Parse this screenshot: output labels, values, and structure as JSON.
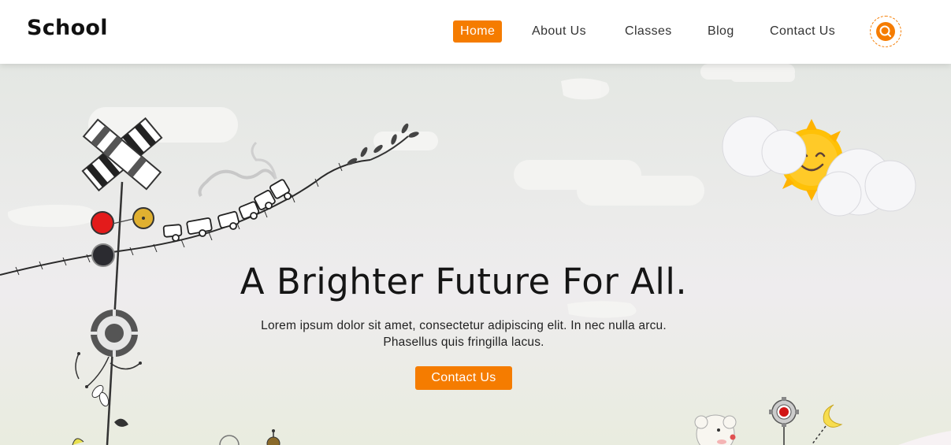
{
  "brand": {
    "logo_text": "School",
    "accent_color": "#f57c00"
  },
  "nav": {
    "items": [
      {
        "label": "Home",
        "active": true
      },
      {
        "label": "About Us",
        "active": false
      },
      {
        "label": "Classes",
        "active": false
      },
      {
        "label": "Blog",
        "active": false
      },
      {
        "label": "Contact Us",
        "active": false
      }
    ],
    "search_icon": "search-icon"
  },
  "hero": {
    "title": "A Brighter Future For All.",
    "text_line1": "Lorem ipsum dolor sit amet, consectetur adipiscing elit. In nec nulla arcu.",
    "text_line2": "Phasellus quis fringilla lacus.",
    "cta_label": "Contact Us",
    "decorations": [
      "cloud-icon",
      "sun-icon",
      "train-icon",
      "windmill-icon",
      "flower-icon",
      "moon-icon",
      "teddy-bear-icon"
    ]
  }
}
